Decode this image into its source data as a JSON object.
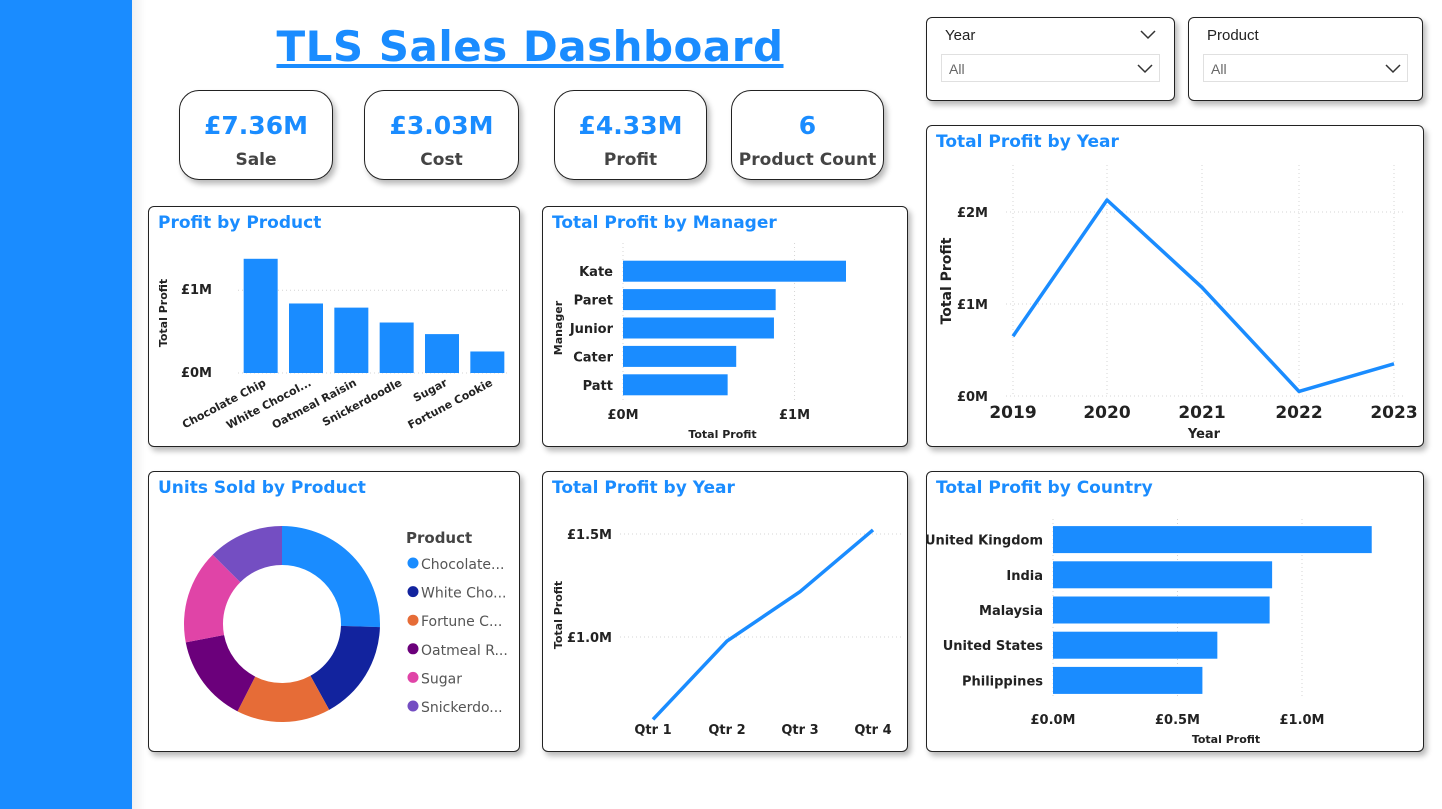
{
  "dashboard": {
    "title": "TLS Sales Dashboard"
  },
  "kpis": [
    {
      "value": "£7.36M",
      "label": "Sale"
    },
    {
      "value": "£3.03M",
      "label": "Cost"
    },
    {
      "value": "£4.33M",
      "label": "Profit"
    },
    {
      "value": "6",
      "label": "Product Count"
    }
  ],
  "slicers": [
    {
      "title": "Year",
      "value": "All"
    },
    {
      "title": "Product",
      "value": "All"
    }
  ],
  "colors": {
    "accent": "#1a8cff",
    "sidebar": "#1a8cff",
    "text": "#222222"
  },
  "icons": {
    "dropdown": "chevron-down-icon"
  },
  "chart_data": [
    {
      "id": "profit_by_product",
      "type": "bar",
      "title": "Profit by Product",
      "ylabel": "Total Profit",
      "categories": [
        "Chocolate Chip",
        "White Chocol...",
        "Oatmeal Raisin",
        "Snickerdoodle",
        "Sugar",
        "Fortune Cookie"
      ],
      "values": [
        1.38,
        0.84,
        0.79,
        0.61,
        0.47,
        0.26
      ],
      "yticks": [
        0,
        1
      ],
      "ytick_labels": [
        "£0M",
        "£1M"
      ],
      "ylim": [
        0,
        1.45
      ]
    },
    {
      "id": "profit_by_manager",
      "type": "bar",
      "orientation": "horizontal",
      "title": "Total Profit by Manager",
      "xlabel": "Total Profit",
      "ylabel": "Manager",
      "categories": [
        "Kate",
        "Paret",
        "Junior",
        "Cater",
        "Patt"
      ],
      "values": [
        1.3,
        0.89,
        0.88,
        0.66,
        0.61
      ],
      "xticks": [
        0,
        1
      ],
      "xtick_labels": [
        "£0M",
        "£1M"
      ],
      "xlim": [
        0,
        1.3
      ]
    },
    {
      "id": "profit_by_year",
      "type": "line",
      "title": "Total Profit by Year",
      "xlabel": "Year",
      "ylabel": "Total Profit",
      "x": [
        "2019",
        "2020",
        "2021",
        "2022",
        "2023"
      ],
      "values": [
        0.65,
        2.13,
        1.18,
        0.05,
        0.35
      ],
      "yticks": [
        0,
        1,
        2
      ],
      "ytick_labels": [
        "£0M",
        "£1M",
        "£2M"
      ],
      "ylim": [
        0,
        2.1
      ]
    },
    {
      "id": "units_by_product",
      "type": "pie",
      "variant": "donut",
      "title": "Units Sold by Product",
      "legend_title": "Product",
      "legend_position": "right",
      "labels": [
        "Chocolate...",
        "White Cho...",
        "Fortune C...",
        "Oatmeal R...",
        "Sugar",
        "Snickerdo..."
      ],
      "values": [
        25.5,
        16.5,
        15.5,
        14.5,
        15.5,
        12.5
      ],
      "colors": [
        "#1a8cff",
        "#12239e",
        "#e66c37",
        "#6b007b",
        "#e044a7",
        "#744ec2"
      ]
    },
    {
      "id": "profit_by_quarter",
      "type": "line",
      "title": "Total Profit by Year",
      "ylabel": "Total Profit",
      "x": [
        "Qtr 1",
        "Qtr 2",
        "Qtr 3",
        "Qtr 4"
      ],
      "values": [
        0.6,
        0.98,
        1.22,
        1.52
      ],
      "yticks": [
        1.0,
        1.5
      ],
      "ytick_labels": [
        "£1.0M",
        "£1.5M"
      ]
    },
    {
      "id": "profit_by_country",
      "type": "bar",
      "orientation": "horizontal",
      "title": "Total Profit by Country",
      "xlabel": "Total Profit",
      "categories": [
        "United Kingdom",
        "India",
        "Malaysia",
        "United States",
        "Philippines"
      ],
      "values": [
        1.28,
        0.88,
        0.87,
        0.66,
        0.6
      ],
      "xticks": [
        0,
        0.5,
        1.0
      ],
      "xtick_labels": [
        "£0.0M",
        "£0.5M",
        "£1.0M"
      ]
    }
  ]
}
